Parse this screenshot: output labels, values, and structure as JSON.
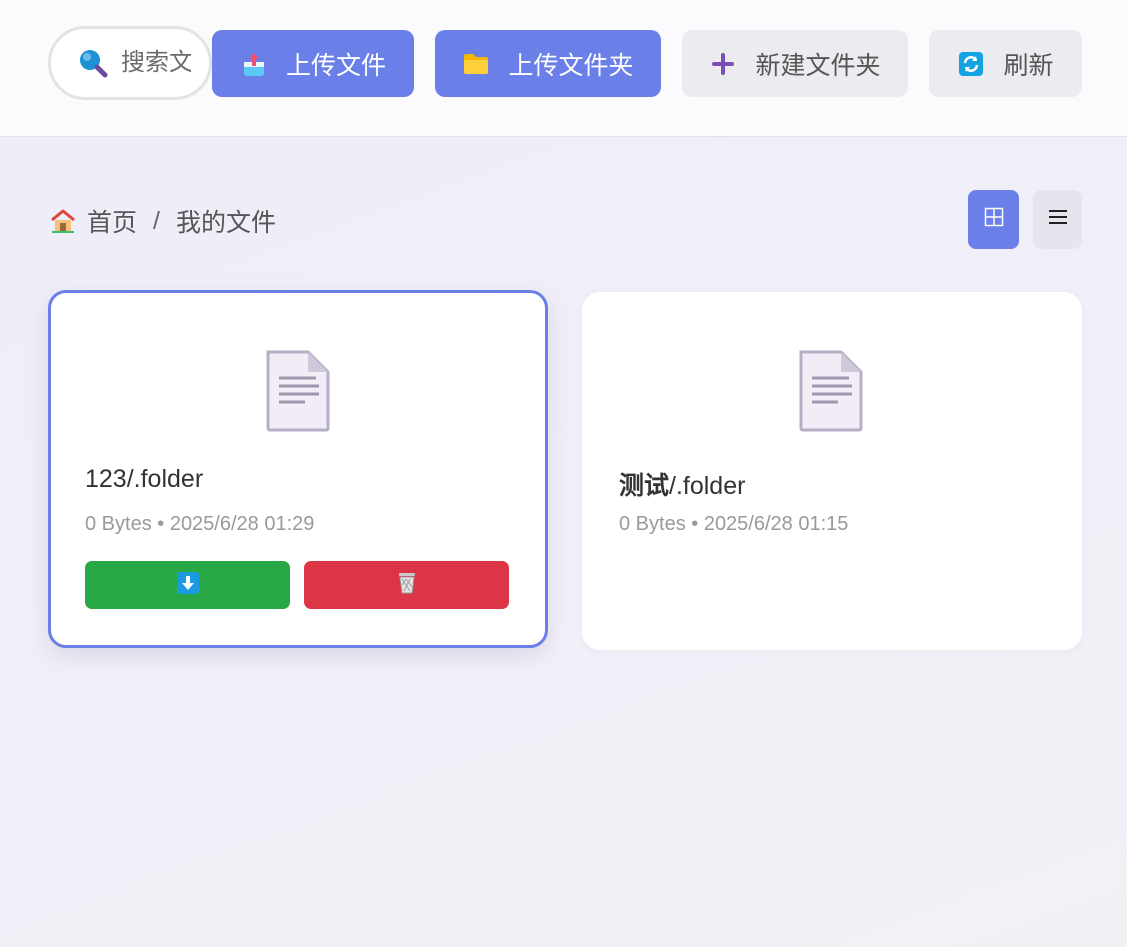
{
  "toolbar": {
    "search_placeholder": "搜索文件",
    "upload_file": "上传文件",
    "upload_folder": "上传文件夹",
    "new_folder": "新建文件夹",
    "refresh": "刷新"
  },
  "breadcrumb": {
    "home": "首页",
    "separator": "/",
    "current": "我的文件"
  },
  "view": {
    "grid_icon": "⊞",
    "list_icon": "☰",
    "active": "grid"
  },
  "files": [
    {
      "name": "123/.folder",
      "meta": "0 Bytes • 2025/6/28 01:29",
      "selected": true,
      "icon": "document-icon"
    },
    {
      "name_bold": "测试",
      "name_rest": "/.folder",
      "meta": "0 Bytes • 2025/6/28 01:15",
      "selected": false,
      "icon": "document-icon"
    }
  ],
  "colors": {
    "primary": "#6a7fe8",
    "download": "#28a745",
    "delete": "#dc3545"
  }
}
